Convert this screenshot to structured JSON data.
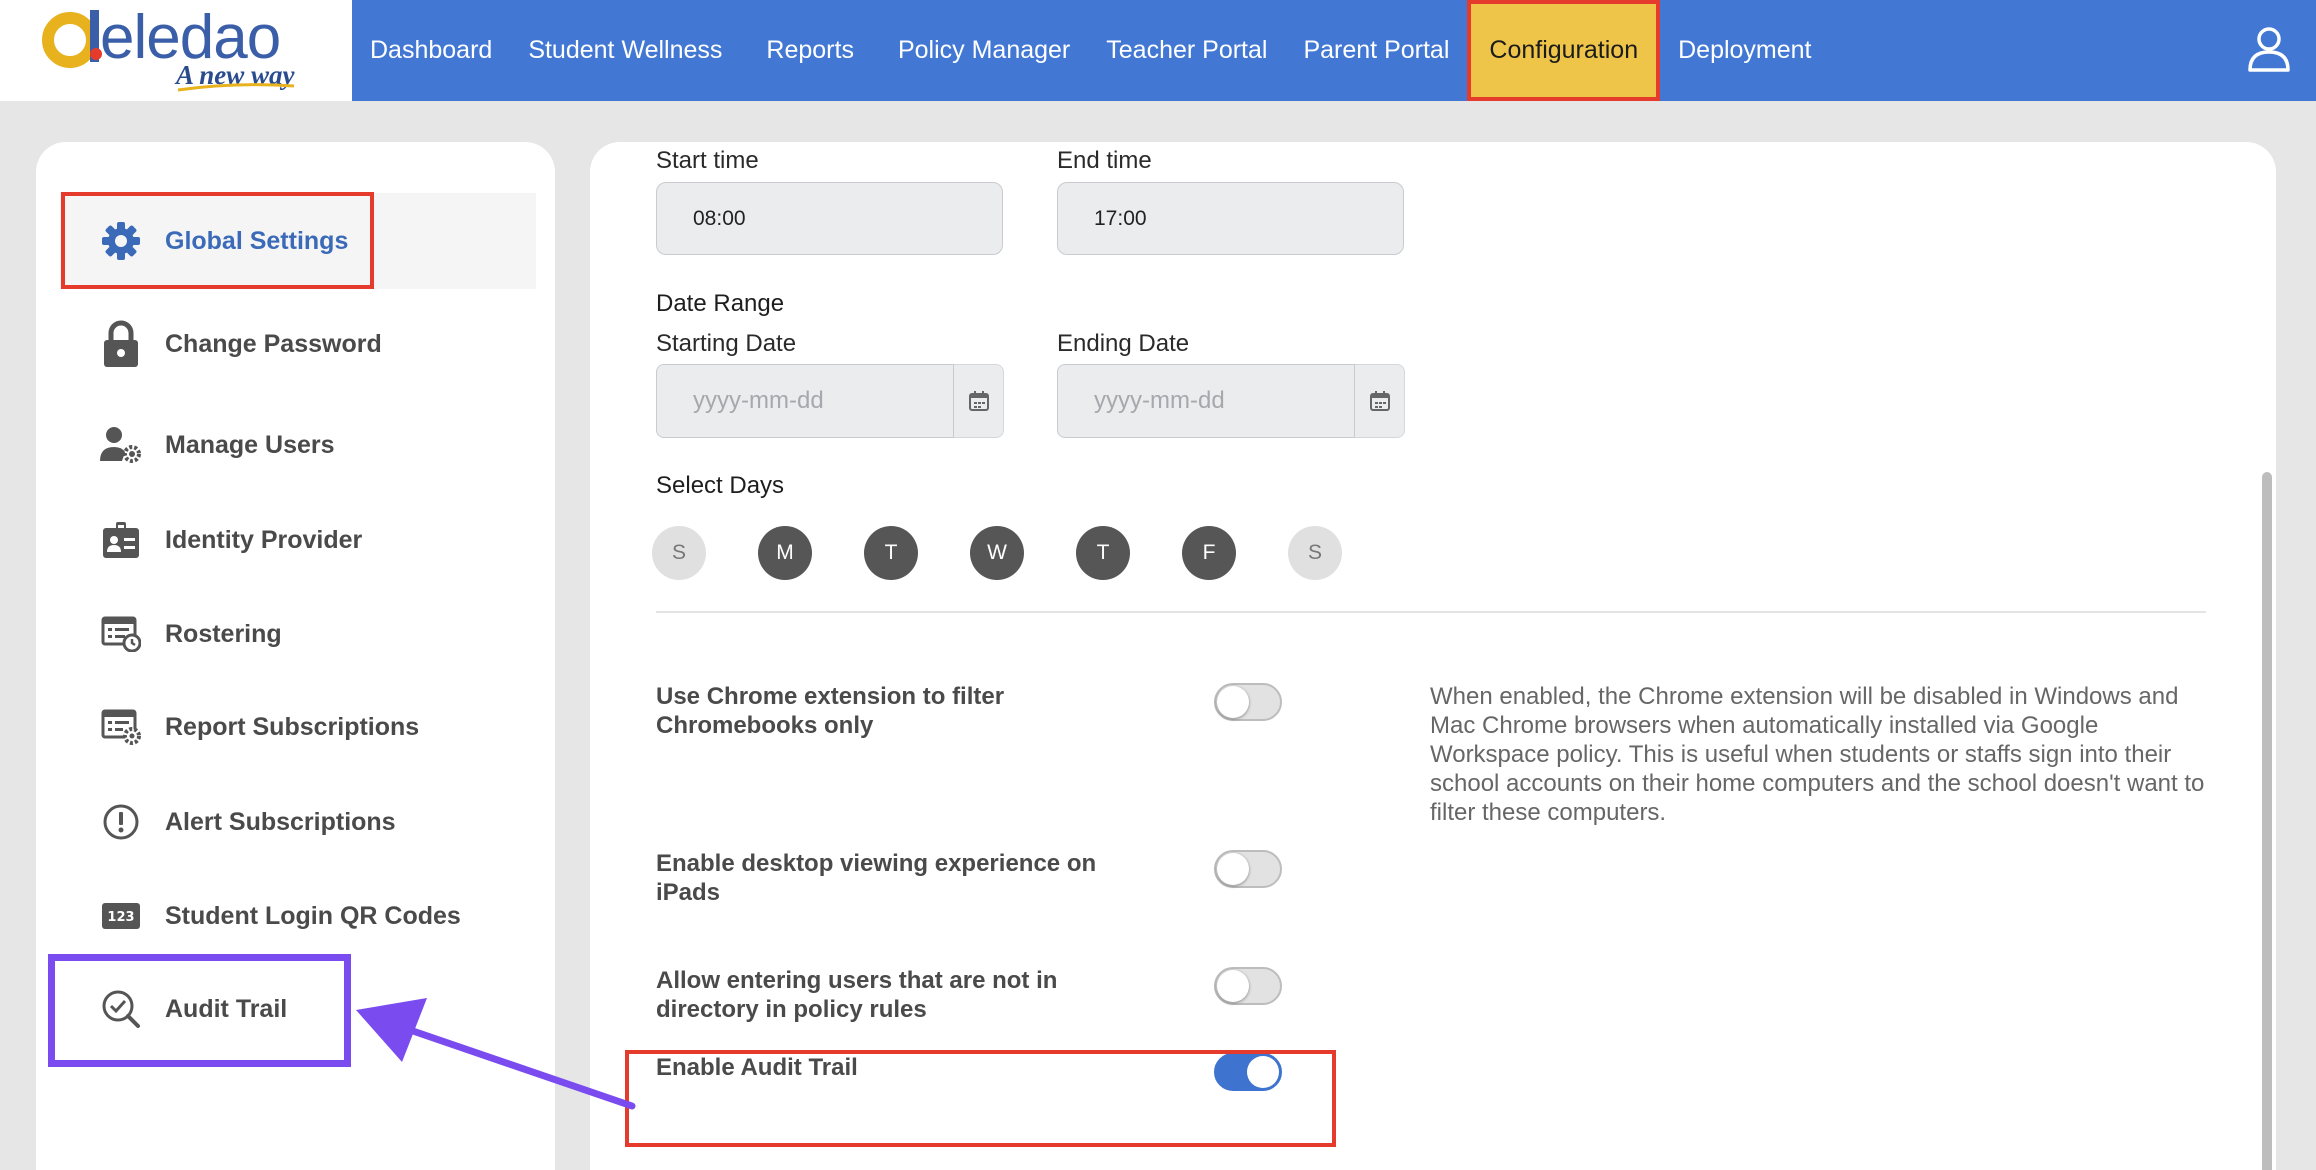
{
  "header": {
    "logo_text": "eledao",
    "logo_tagline": "A new way",
    "nav": [
      {
        "label": "Dashboard",
        "active": false
      },
      {
        "label": "Student Wellness",
        "active": false
      },
      {
        "label": "Reports",
        "active": false
      },
      {
        "label": "Policy Manager",
        "active": false
      },
      {
        "label": "Teacher Portal",
        "active": false
      },
      {
        "label": "Parent Portal",
        "active": false
      },
      {
        "label": "Configuration",
        "active": true
      },
      {
        "label": "Deployment",
        "active": false
      }
    ],
    "user_icon": "user-icon"
  },
  "sidebar": {
    "items": [
      {
        "label": "Global Settings",
        "icon": "gear-icon",
        "active": true
      },
      {
        "label": "Change Password",
        "icon": "lock-icon",
        "active": false
      },
      {
        "label": "Manage Users",
        "icon": "user-gear-icon",
        "active": false
      },
      {
        "label": "Identity Provider",
        "icon": "id-card-icon",
        "active": false
      },
      {
        "label": "Rostering",
        "icon": "roster-icon",
        "active": false
      },
      {
        "label": "Report Subscriptions",
        "icon": "report-gear-icon",
        "active": false
      },
      {
        "label": "Alert Subscriptions",
        "icon": "alert-icon",
        "active": false
      },
      {
        "label": "Student Login QR Codes",
        "icon": "qr-123-icon",
        "active": false
      },
      {
        "label": "Audit Trail",
        "icon": "audit-search-icon",
        "active": false
      }
    ]
  },
  "main": {
    "start_time": {
      "label": "Start time",
      "value": "08:00"
    },
    "end_time": {
      "label": "End time",
      "value": "17:00"
    },
    "date_range": {
      "heading": "Date Range",
      "starting": {
        "label": "Starting Date",
        "placeholder": "yyyy-mm-dd"
      },
      "ending": {
        "label": "Ending Date",
        "placeholder": "yyyy-mm-dd"
      }
    },
    "select_days": {
      "heading": "Select Days",
      "days": [
        {
          "label": "S",
          "selected": false
        },
        {
          "label": "M",
          "selected": true
        },
        {
          "label": "T",
          "selected": true
        },
        {
          "label": "W",
          "selected": true
        },
        {
          "label": "T",
          "selected": true
        },
        {
          "label": "F",
          "selected": true
        },
        {
          "label": "S",
          "selected": false
        }
      ]
    },
    "settings": [
      {
        "label": "Use Chrome extension to filter Chromebooks only",
        "enabled": false
      },
      {
        "label": "Enable desktop viewing experience on iPads",
        "enabled": false
      },
      {
        "label": "Allow entering users that are not in directory in policy rules",
        "enabled": false
      },
      {
        "label": "Enable Audit Trail",
        "enabled": true
      }
    ],
    "chrome_description": "When enabled, the Chrome extension will be disabled in Windows and Mac Chrome browsers when automatically installed via Google Workspace policy. This is useful when students or staffs sign into their school accounts on their home computers and the school doesn't want to filter these computers."
  },
  "colors": {
    "nav_bg": "#4278d4",
    "nav_active_bg": "#efc549",
    "highlight_red": "#e53b2c",
    "highlight_purple": "#7a4cf0",
    "toggle_on": "#3e74cf",
    "day_selected": "#565656"
  }
}
